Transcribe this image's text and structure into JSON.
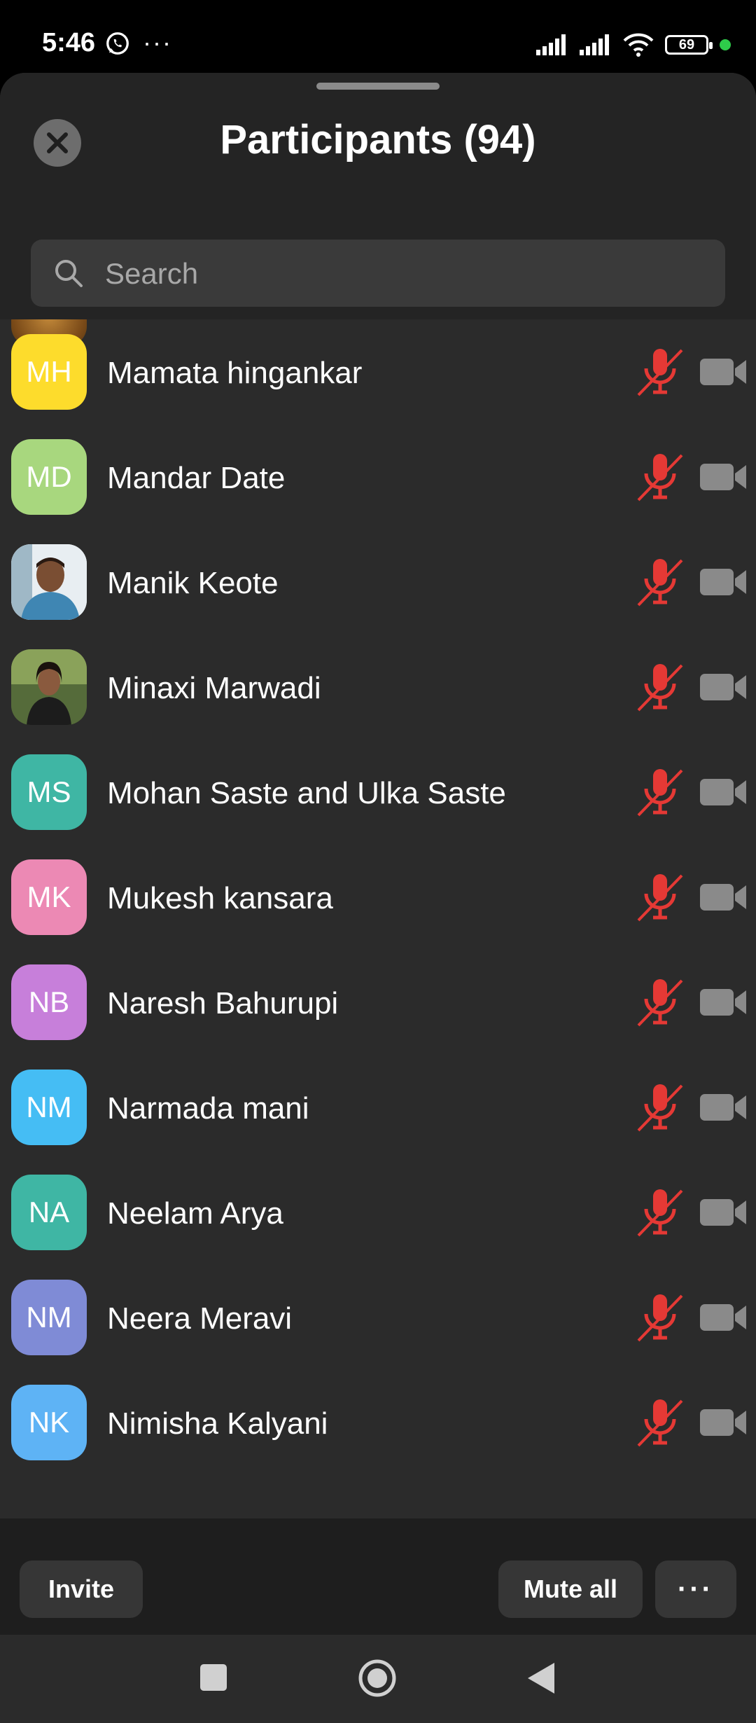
{
  "status_bar": {
    "time": "5:46",
    "app_icons": [
      "whatsapp-icon"
    ],
    "more": "···",
    "battery": "69"
  },
  "header": {
    "title": "Participants (94)",
    "close_icon": "close-icon"
  },
  "search": {
    "placeholder": "Search",
    "value": ""
  },
  "participants": [
    {
      "initials": "MH",
      "name": "Mamata hingankar",
      "color": "#fddc2c",
      "photo": false
    },
    {
      "initials": "MD",
      "name": "Mandar Date",
      "color": "#a8d77e",
      "photo": false
    },
    {
      "initials": "",
      "name": "Manik Keote",
      "color": "#8fb6c9",
      "photo": true
    },
    {
      "initials": "",
      "name": "Minaxi Marwadi",
      "color": "#3d4a2c",
      "photo": true
    },
    {
      "initials": "MS",
      "name": "Mohan Saste and Ulka Saste",
      "color": "#3fb6a4",
      "photo": false
    },
    {
      "initials": "MK",
      "name": "Mukesh kansara",
      "color": "#ec89b4",
      "photo": false
    },
    {
      "initials": "NB",
      "name": "Naresh Bahurupi",
      "color": "#c77fda",
      "photo": false
    },
    {
      "initials": "NM",
      "name": "Narmada mani",
      "color": "#45bdf4",
      "photo": false
    },
    {
      "initials": "NA",
      "name": "Neelam Arya",
      "color": "#3fb6a4",
      "photo": false
    },
    {
      "initials": "NM",
      "name": "Neera Meravi",
      "color": "#7f8bd6",
      "photo": false
    },
    {
      "initials": "NK",
      "name": "Nimisha Kalyani",
      "color": "#5eb3f5",
      "photo": false
    }
  ],
  "status_icons": {
    "mic": "mic-muted-icon",
    "video": "video-off-icon",
    "muted_color": "#e53935",
    "video_color": "#8a8a8a"
  },
  "footer": {
    "invite": "Invite",
    "mute_all": "Mute all",
    "more": "···"
  },
  "nav": [
    "recents-icon",
    "home-icon",
    "back-icon"
  ]
}
